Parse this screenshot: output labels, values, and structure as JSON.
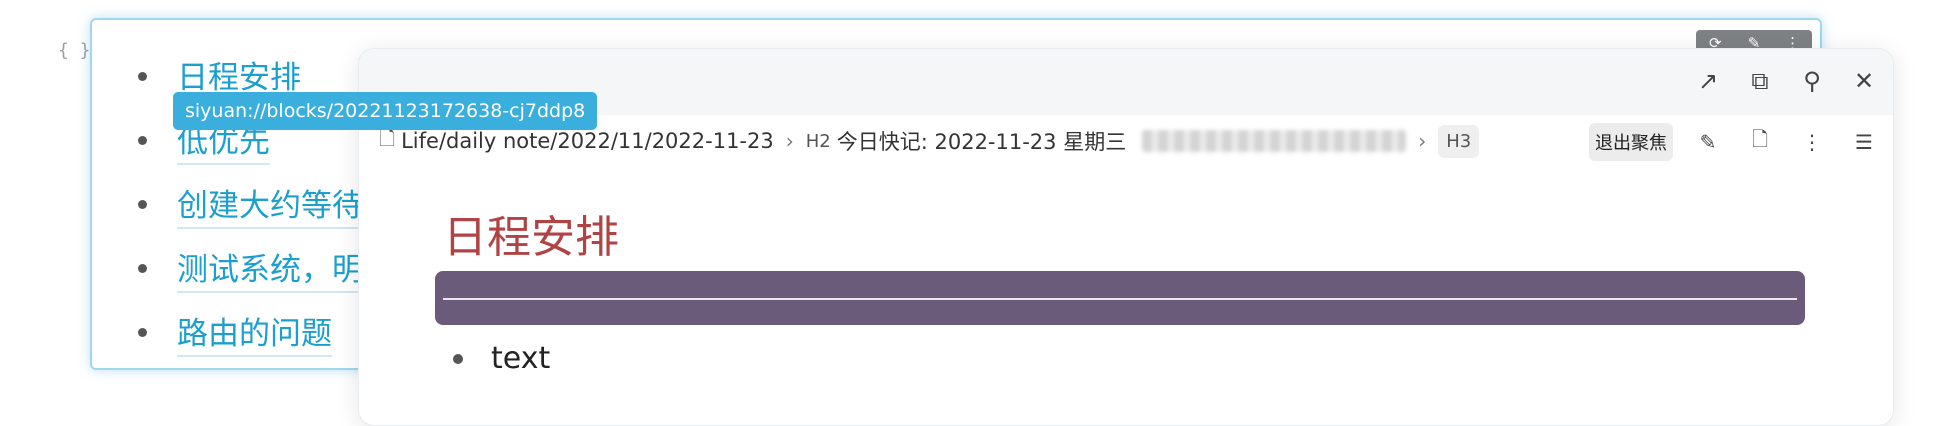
{
  "brace_glyph": "{ }",
  "ref_block": {
    "actions": [
      "⟳",
      "✎",
      "⋮"
    ],
    "items": [
      {
        "text": "日程安排"
      },
      {
        "text": "低优先"
      },
      {
        "text": "创建大约等待"
      },
      {
        "text": "测试系统，明"
      },
      {
        "text": "路由的问题"
      }
    ]
  },
  "tooltip": {
    "text": "siyuan://blocks/20221123172638-cj7ddp8"
  },
  "popover": {
    "header_actions": [
      {
        "name": "open-icon",
        "glyph": "↗"
      },
      {
        "name": "open-window-icon",
        "glyph": "⧉"
      },
      {
        "name": "unpin-icon",
        "glyph": "⚲"
      },
      {
        "name": "close-icon",
        "glyph": "✕"
      }
    ],
    "breadcrumb": {
      "path": "Life/daily note/2022/11/2022-11-23",
      "h2_tag": "H2",
      "h2_text": "今日快记: 2022-11-23 星期三",
      "h3_tag": "H3",
      "exit_focus": "退出聚焦"
    },
    "title": "日程安排",
    "list_item": "text"
  },
  "colors": {
    "link": "#1a9fcf",
    "tooltip": "#3aaedc",
    "heading_red": "#b04444",
    "purple_block": "#6b5b7b"
  }
}
